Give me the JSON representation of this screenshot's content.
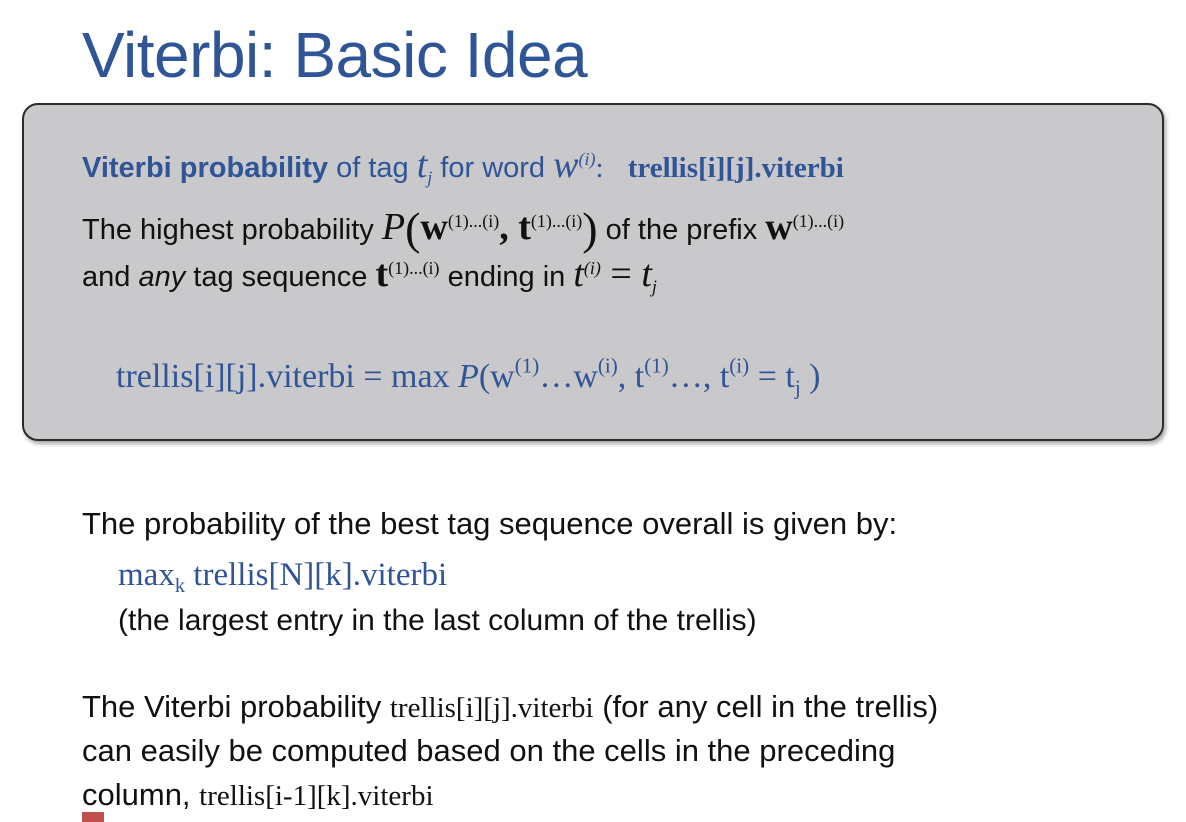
{
  "title": "Viterbi: Basic Idea",
  "definition": {
    "line1": {
      "term": "Viterbi probability",
      "text1": " of tag ",
      "tag_var": "t",
      "tag_sub": "j",
      "text2": " for word ",
      "word_var": "w",
      "word_sup": "(i)",
      "colon": ":",
      "code": "trellis[i][j].viterbi"
    },
    "line2": {
      "text1": "The highest probability ",
      "P": "P",
      "w_bold": "w",
      "w_sup": "(1)...(i)",
      "comma": ", ",
      "t_bold": "t",
      "t_sup": "(1)...(i)",
      "text2": " of the prefix ",
      "w2_bold": "w",
      "w2_sup": "(1)...(i)"
    },
    "line3": {
      "text1": "and ",
      "any": "any",
      "text2": " tag sequence ",
      "t_bold": "t",
      "t_sup": "(1)...(i)",
      "text3": " ending in ",
      "t_var": "t",
      "t_var_sup": "(i)",
      "eq": " = ",
      "t_j": "t",
      "t_j_sub": "j"
    },
    "formula": {
      "lhs": "trellis[i][j].viterbi = max ",
      "P": "P",
      "open": "(w",
      "sup1": "(1)",
      "mid1": "…w",
      "sup2": "(i)",
      "mid2": ", t",
      "sup3": "(1)",
      "mid3": "…, t",
      "sup4": "(i)",
      "mid4": " = t",
      "sub5": "j",
      "close": " )"
    }
  },
  "body": {
    "p1": "The probability of the best tag sequence overall is given by:",
    "p1_formula_max": "max",
    "p1_formula_sub": "k",
    "p1_formula_rest": " trellis[N][k].viterbi",
    "p1_note": "(the largest entry in the last column of the trellis)",
    "p2_text1": "The Viterbi probability ",
    "p2_code": "trellis[i][j].viterbi",
    "p2_text2": " (for any cell in the trellis)",
    "p2_line2": "can easily be computed based on the cells in the preceding",
    "p2_line3": "column, ",
    "p2_code2": "trellis[i-1][k].viterbi"
  },
  "colors": {
    "accent": "#2f5597",
    "box_bg": "#c9c9cc"
  }
}
